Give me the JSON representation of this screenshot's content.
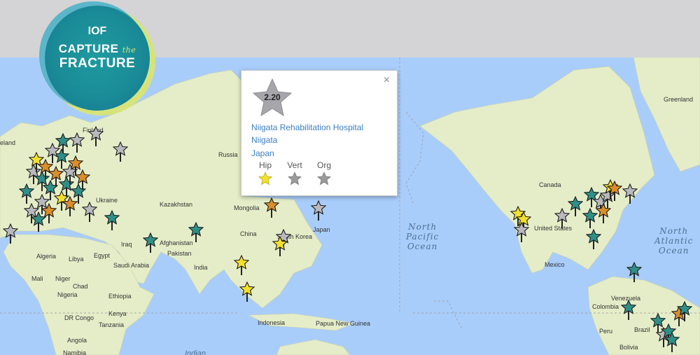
{
  "logo": {
    "line_iof": "IOF",
    "line_capture": "CAPTURE",
    "line_the": "the",
    "line_fracture": "FRACTURE"
  },
  "popup": {
    "score": "2.20",
    "hospital": "Niigata Rehabilitation Hospital",
    "city": "Niigata",
    "country": "Japan",
    "close_label": "×",
    "categories": [
      {
        "label": "Hip",
        "color": "#f3e02c"
      },
      {
        "label": "Vert",
        "color": "#9a9a9a"
      },
      {
        "label": "Org",
        "color": "#9a9a9a"
      }
    ]
  },
  "map": {
    "labels": {
      "finland": "Finland",
      "iceland": "eland",
      "russia": "Russia",
      "ukraine": "Ukraine",
      "kazakhstan": "Kazakhstan",
      "mongolia": "Mongolia",
      "china": "China",
      "south_korea": "South Korea",
      "japan": "Japan",
      "afghanistan": "Afghanistan",
      "pakistan": "Pakistan",
      "india": "India",
      "iraq": "Iraq",
      "saudi_arabia": "Saudi Arabia",
      "egypt": "Egypt",
      "libya": "Libya",
      "algeria": "Algeria",
      "mali": "Mali",
      "niger": "Niger",
      "chad": "Chad",
      "nigeria": "Nigeria",
      "ethiopia": "Ethiopia",
      "kenya": "Kenya",
      "tanzania": "Tanzania",
      "dr_congo": "DR Congo",
      "angola": "Angola",
      "namibia": "Namibia",
      "indonesia": "Indonesia",
      "papua_new_guinea": "Papua New Guinea",
      "indian": "Indian",
      "canada": "Canada",
      "united_states": "United States",
      "mexico": "Mexico",
      "greenland": "Greenland",
      "venezuela": "Venezuela",
      "colombia": "Colombia",
      "brazil": "Brazil",
      "bolivia": "Bolivia",
      "peru": "Peru",
      "north_pacific_ocean": "North\nPacific\nOcean",
      "north_atlantic_ocean": "North\nAtlantic\nOcean"
    }
  },
  "colors": {
    "teal": "#2f8f86",
    "orange": "#d98d2b",
    "yellow": "#f3e02c",
    "gray": "#b9b9bd",
    "water": "#a9cdfa",
    "land": "#e4edc8"
  }
}
